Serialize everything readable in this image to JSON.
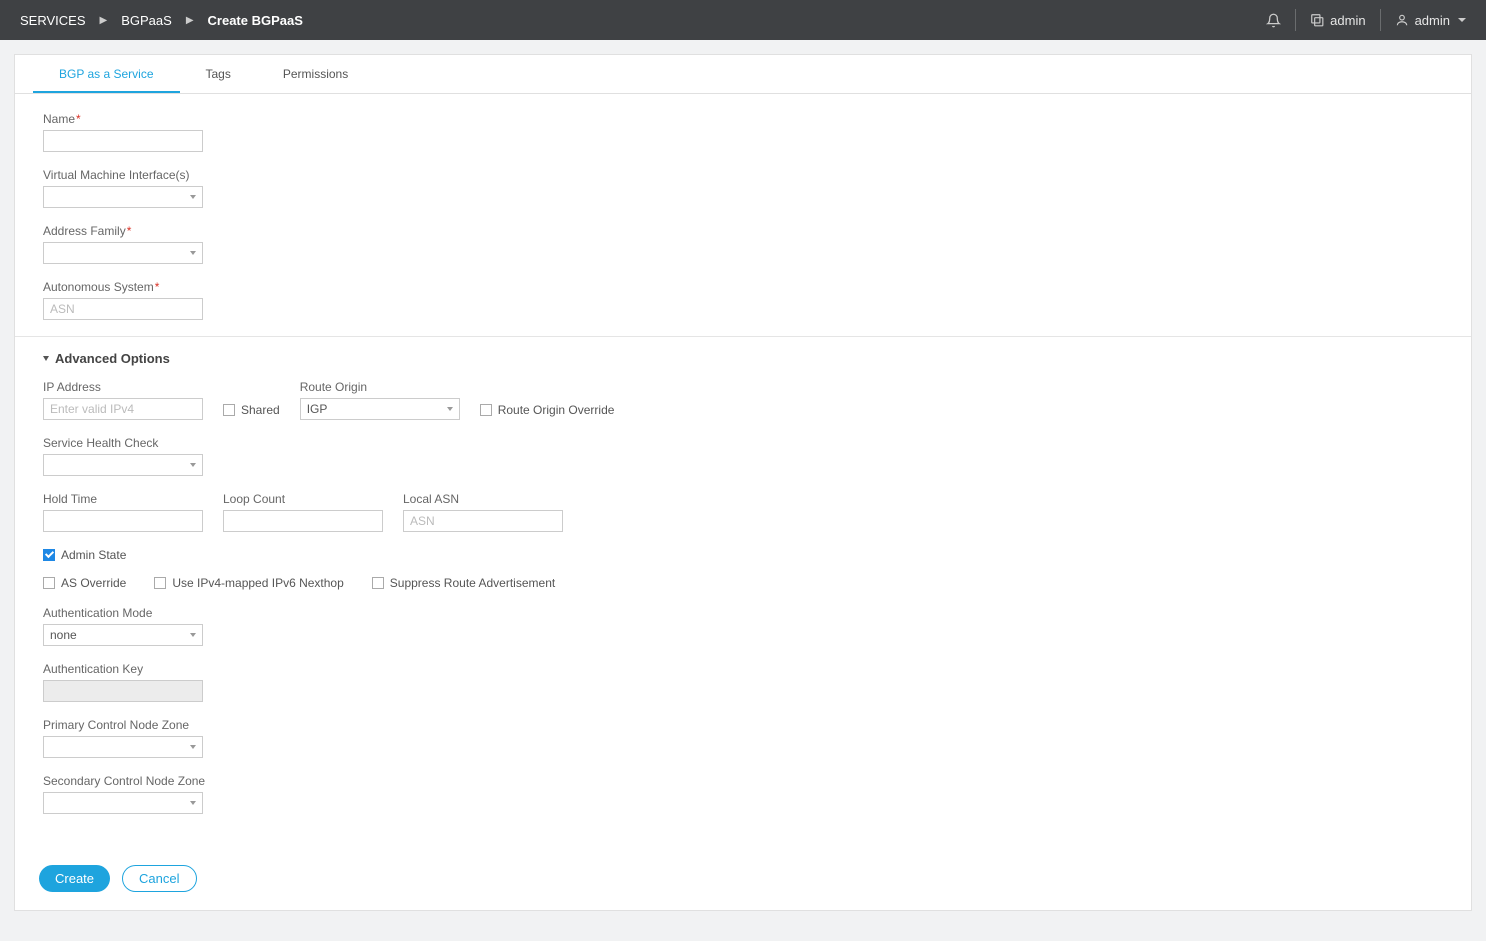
{
  "breadcrumb": {
    "root": "SERVICES",
    "mid": "BGPaaS",
    "current": "Create BGPaaS"
  },
  "topbar": {
    "domain_label": "admin",
    "user_label": "admin"
  },
  "tabs": {
    "bgp": "BGP as a Service",
    "tags": "Tags",
    "permissions": "Permissions"
  },
  "labels": {
    "name": "Name",
    "vmi": "Virtual Machine Interface(s)",
    "addr_family": "Address Family",
    "asn": "Autonomous System",
    "asn_placeholder": "ASN",
    "advanced": "Advanced Options",
    "ip_addr": "IP Address",
    "ip_placeholder": "Enter valid IPv4",
    "shared": "Shared",
    "route_origin": "Route Origin",
    "route_origin_value": "IGP",
    "roo": "Route Origin Override",
    "svc_health": "Service Health Check",
    "hold_time": "Hold Time",
    "loop_count": "Loop Count",
    "local_asn": "Local ASN",
    "local_asn_placeholder": "ASN",
    "admin_state": "Admin State",
    "as_override": "AS Override",
    "ipv4_mapped": "Use IPv4-mapped IPv6 Nexthop",
    "suppress": "Suppress Route Advertisement",
    "auth_mode": "Authentication Mode",
    "auth_mode_value": "none",
    "auth_key": "Authentication Key",
    "primary_zone": "Primary Control Node Zone",
    "secondary_zone": "Secondary Control Node Zone"
  },
  "buttons": {
    "create": "Create",
    "cancel": "Cancel"
  }
}
